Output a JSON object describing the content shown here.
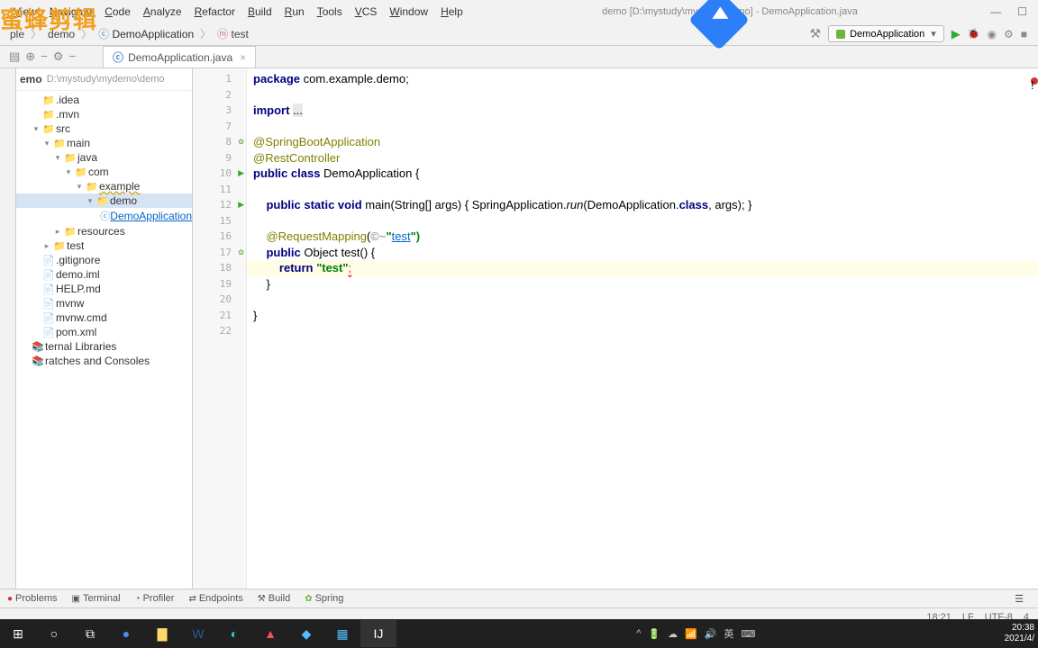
{
  "watermark": "蜜蜂剪辑",
  "title_path": "demo [D:\\mystudy\\mydemo\\demo] - DemoApplication.java",
  "menu": [
    "View",
    "Navigate",
    "Code",
    "Analyze",
    "Refactor",
    "Build",
    "Run",
    "Tools",
    "VCS",
    "Window",
    "Help"
  ],
  "run_config": "DemoApplication",
  "breadcrumbs": {
    "items": [
      "ple",
      "demo",
      "DemoApplication",
      "test"
    ]
  },
  "tab_active": "DemoApplication.java",
  "project": {
    "name": "emo",
    "path": "D:\\mystudy\\mydemo\\demo",
    "nodes": [
      {
        "indent": 0,
        "icon": "dir",
        "label": ".idea",
        "arrow": ""
      },
      {
        "indent": 0,
        "icon": "dir",
        "label": ".mvn",
        "arrow": ""
      },
      {
        "indent": 0,
        "icon": "dir",
        "label": "src",
        "arrow": "▾"
      },
      {
        "indent": 1,
        "icon": "dir",
        "label": "main",
        "arrow": "▾"
      },
      {
        "indent": 2,
        "icon": "java-dir",
        "label": "java",
        "arrow": "▾"
      },
      {
        "indent": 3,
        "icon": "dir",
        "label": "com",
        "arrow": "▾"
      },
      {
        "indent": 4,
        "icon": "dir",
        "label": "example",
        "arrow": "▾",
        "underline": true
      },
      {
        "indent": 5,
        "icon": "dir",
        "label": "demo",
        "arrow": "▾",
        "sel": true
      },
      {
        "indent": 6,
        "icon": "cls",
        "label": "DemoApplication",
        "arrow": "",
        "link": true
      },
      {
        "indent": 2,
        "icon": "dir",
        "label": "resources",
        "arrow": "▸"
      },
      {
        "indent": 1,
        "icon": "dir",
        "label": "test",
        "arrow": "▸"
      },
      {
        "indent": 0,
        "icon": "file",
        "label": ".gitignore",
        "arrow": ""
      },
      {
        "indent": 0,
        "icon": "file",
        "label": "demo.iml",
        "arrow": ""
      },
      {
        "indent": 0,
        "icon": "file",
        "label": "HELP.md",
        "arrow": ""
      },
      {
        "indent": 0,
        "icon": "file",
        "label": "mvnw",
        "arrow": ""
      },
      {
        "indent": 0,
        "icon": "file",
        "label": "mvnw.cmd",
        "arrow": ""
      },
      {
        "indent": 0,
        "icon": "file",
        "label": "pom.xml",
        "arrow": ""
      },
      {
        "indent": -1,
        "icon": "lib",
        "label": "ternal Libraries",
        "arrow": ""
      },
      {
        "indent": -1,
        "icon": "lib",
        "label": "ratches and Consoles",
        "arrow": ""
      }
    ]
  },
  "lines": [
    {
      "n": 1
    },
    {
      "n": 2
    },
    {
      "n": 3
    },
    {
      "n": 7
    },
    {
      "n": 8,
      "spring": true
    },
    {
      "n": 9
    },
    {
      "n": 10,
      "run": true
    },
    {
      "n": 11
    },
    {
      "n": 12,
      "run": true
    },
    {
      "n": 15
    },
    {
      "n": 16
    },
    {
      "n": 17,
      "spring": true
    },
    {
      "n": 18
    },
    {
      "n": 19
    },
    {
      "n": 20
    },
    {
      "n": 21
    },
    {
      "n": 22
    }
  ],
  "code": {
    "l1_pkg": "package",
    "l1_rest": " com.example.demo;",
    "l3_imp": "import ",
    "l3_dots": "...",
    "l5_ann": "@SpringBootApplication",
    "l6_ann": "@RestController",
    "l7_p": "public class ",
    "l7_cls": "DemoApplication",
    " l7_brace": " {",
    "l9_pre": "    ",
    "l9_mod": "public static void ",
    "l9_main": "main",
    "l9_args": "(String[] args) { SpringApplication.",
    "l9_run": "run",
    "l9_rest": "(DemoApplication.",
    "l9_cls": "class",
    "l9_end": ", args); }",
    "l11_pre": "    ",
    "l11_ann": "@RequestMapping",
    "l11_par": "(",
    "l11_ic": "©~",
    "l11_q": "\"",
    "l11_link": "test",
    "l11_end": "\")",
    "l12_pre": "    ",
    "l12_mod": "public ",
    "l12_obj": "Object ",
    "l12_name": "test",
    "l12_par": "() {",
    "l13_pre": "        ",
    "l13_ret": "return ",
    "l13_str": "\"test\"",
    "l13_semi": ";",
    "l14": "    }",
    "l16": "}"
  },
  "bottom_panels": [
    "Problems",
    "Terminal",
    "Profiler",
    "Endpoints",
    "Build",
    "Spring"
  ],
  "status": {
    "pos": "18:21",
    "lf": "LF",
    "enc": "UTF-8",
    "sp": "4"
  },
  "taskbar": {
    "time": "20:38",
    "date": "2021/4/",
    "lang": "英"
  }
}
